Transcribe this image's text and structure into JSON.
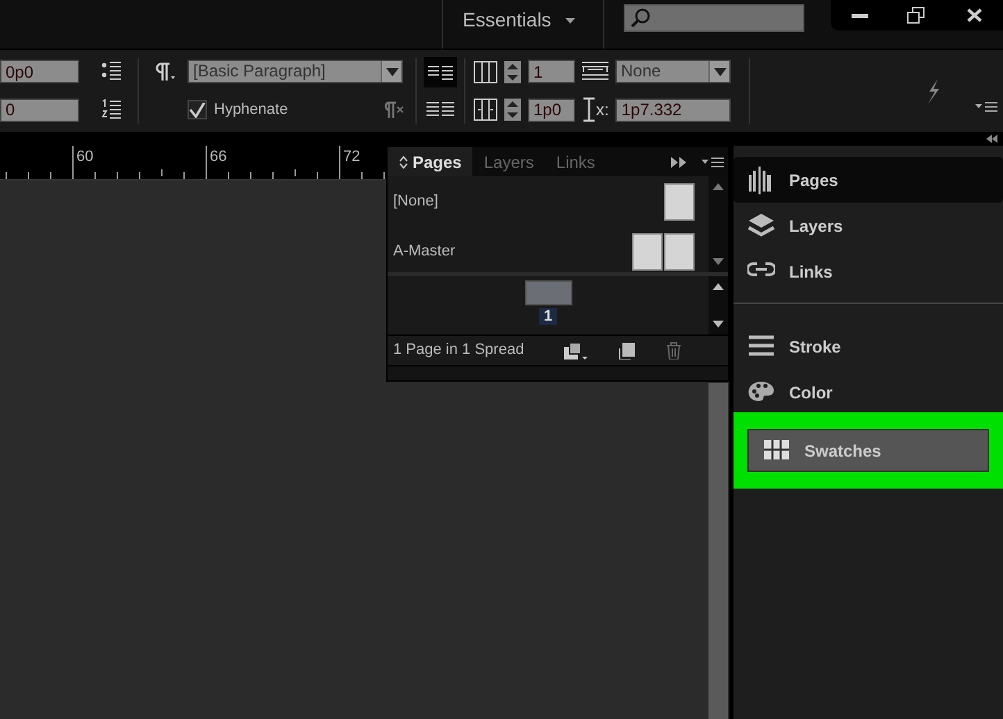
{
  "window": {
    "workspace": "Essentials"
  },
  "control_bar": {
    "left_fields": [
      "0p0",
      "0"
    ],
    "paragraph_style": "[Basic Paragraph]",
    "hyphenate": {
      "label": "Hyphenate",
      "checked": true
    },
    "columns": "1",
    "gutter": "1p0",
    "span": "None",
    "x_label": "x:",
    "x_value": "1p7.332"
  },
  "ruler": {
    "labels": [
      "60",
      "66",
      "72"
    ]
  },
  "pages_panel": {
    "tabs": [
      {
        "label": "Pages",
        "selected": true
      },
      {
        "label": "Layers",
        "selected": false
      },
      {
        "label": "Links",
        "selected": false
      }
    ],
    "masters": [
      {
        "name": "[None]",
        "kind": "single"
      },
      {
        "name": "A-Master",
        "kind": "spread"
      }
    ],
    "pages": [
      {
        "number": "1",
        "selected": true
      }
    ],
    "status": "1 Page in 1 Spread"
  },
  "dock": {
    "groups": [
      {
        "items": [
          {
            "label": "Pages",
            "kind": "pages",
            "selected": true,
            "highlighted": false
          },
          {
            "label": "Layers",
            "kind": "layers",
            "selected": false,
            "highlighted": false
          },
          {
            "label": "Links",
            "kind": "links",
            "selected": false,
            "highlighted": false
          }
        ]
      },
      {
        "items": [
          {
            "label": "Stroke",
            "kind": "stroke",
            "selected": false,
            "highlighted": false
          },
          {
            "label": "Color",
            "kind": "color",
            "selected": false,
            "highlighted": false
          },
          {
            "label": "Swatches",
            "kind": "swatches",
            "selected": false,
            "highlighted": true
          }
        ]
      }
    ]
  }
}
